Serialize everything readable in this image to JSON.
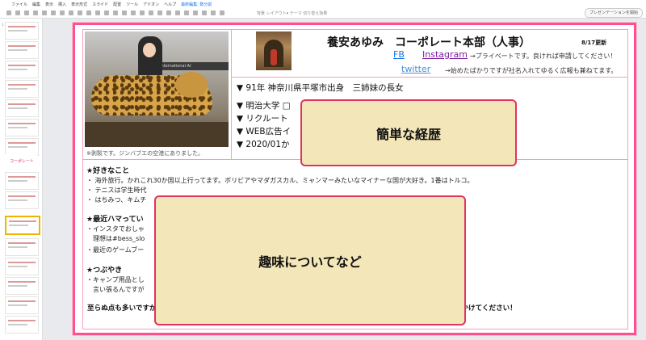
{
  "app": {
    "menus": [
      "ファイル",
      "編集",
      "表示",
      "挿入",
      "表示形式",
      "スライド",
      "配置",
      "ツール",
      "アドオン",
      "ヘルプ"
    ],
    "edit_status": "最終編集: 数分前",
    "toolbar_hint": "背景  レイアウト▾  テーマ  切り替え効果",
    "present_button": "プレゼンテーションを開始"
  },
  "filmstrip": {
    "thumb_logo_text": "コーポレート"
  },
  "slide": {
    "header": {
      "name": "養安あゆみ　コーポレート本部（人事）",
      "updated": "8/17更新",
      "fb_label": "FB",
      "instagram_label": "Instagram",
      "instagram_note": "→プライベートです。良ければ申請してください！",
      "twitter_label": "twitter",
      "twitter_note": "→始めたばかりですが社名入れてゆるく広報も兼ねてます。"
    },
    "photo": {
      "sign_text": "International Ar",
      "caption": "※剥製です。ジンバブエの空港にありました。"
    },
    "profile": {
      "lines": [
        "▼ 91年 神奈川県平塚市出身　三姉妹の長女",
        "▼ 明治大学 □",
        "▼ リクルート",
        "▼ WEB広告イ",
        "▼ 2020/01か"
      ]
    },
    "hobbies": {
      "likes_title": "★好きなこと",
      "likes_items": [
        "・ 海外旅行。かれこれ30か国以上行ってます。ボリビアやマダガスカル、ミャンマーみたいなマイナーな国が大好き。1番はトルコ。",
        "・ テニスは学生時代",
        "・ はちみつ、キムチ　　　　　　　　　　　　　　　　　　　　　　　　　　　　　　　　　　　　　優秀です。"
      ],
      "recent_title": "★最近ハマってい",
      "recent_items": [
        "・インスタでおしゃ",
        "　理想は#bess_slo",
        "・最近のゲームブー"
      ],
      "murmur_title": "★つぶやき",
      "murmur_items": [
        "・キャンプ用品とし　　　　　　　　　　　　　　　　　　　　　　　　　　　　　　　　が欲しいと",
        "　言い張るんですが"
      ],
      "footer": "至らぬ点も多いですが、こんな制度があったらいいな、困ったけどどこに相談しよう…みたいなことがあればお気軽に声かけてください！"
    },
    "overlays": {
      "career": "簡単な経歴",
      "hobby": "趣味についてなど"
    }
  }
}
